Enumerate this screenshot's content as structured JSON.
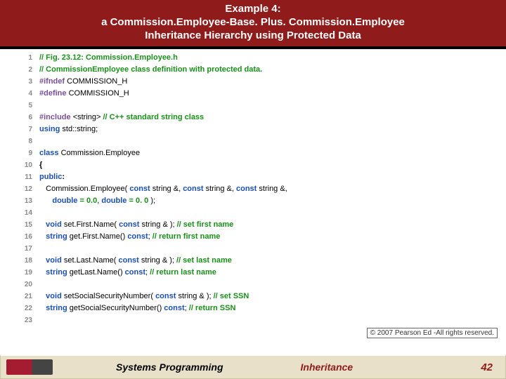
{
  "header": {
    "line1": "Example 4:",
    "line2": "a Commission.Employee-Base. Plus. Commission.Employee",
    "line3": "Inheritance Hierarchy using Protected Data"
  },
  "code": [
    {
      "n": "1",
      "segs": [
        {
          "c": "cmt",
          "t": "// Fig. 23.12: Commission.Employee.h"
        }
      ]
    },
    {
      "n": "2",
      "segs": [
        {
          "c": "cmt",
          "t": "// CommissionEmployee class definition with protected data."
        }
      ]
    },
    {
      "n": "3",
      "segs": [
        {
          "c": "pp",
          "t": "#ifndef "
        },
        {
          "c": "id",
          "t": "COMMISSION_H"
        }
      ]
    },
    {
      "n": "4",
      "segs": [
        {
          "c": "pp",
          "t": "#define "
        },
        {
          "c": "id",
          "t": "COMMISSION_H"
        }
      ]
    },
    {
      "n": "5",
      "segs": []
    },
    {
      "n": "6",
      "segs": [
        {
          "c": "pp",
          "t": "#include "
        },
        {
          "c": "id",
          "t": "<string> "
        },
        {
          "c": "cmt",
          "t": "// C++ standard string class"
        }
      ]
    },
    {
      "n": "7",
      "segs": [
        {
          "c": "kw",
          "t": "using "
        },
        {
          "c": "id",
          "t": "std::string;"
        }
      ]
    },
    {
      "n": "8",
      "segs": []
    },
    {
      "n": "9",
      "segs": [
        {
          "c": "kw",
          "t": "class "
        },
        {
          "c": "id",
          "t": "Commission.Employee"
        }
      ]
    },
    {
      "n": "10",
      "segs": [
        {
          "c": "id bold",
          "t": "{"
        }
      ]
    },
    {
      "n": "11",
      "segs": [
        {
          "c": "kw",
          "t": "public"
        },
        {
          "c": "id bold",
          "t": ":"
        }
      ]
    },
    {
      "n": "12",
      "segs": [
        {
          "c": "id",
          "t": "   Commission.Employee( "
        },
        {
          "c": "kw",
          "t": "const "
        },
        {
          "c": "id",
          "t": "string &, "
        },
        {
          "c": "kw",
          "t": "const "
        },
        {
          "c": "id",
          "t": "string &, "
        },
        {
          "c": "kw",
          "t": "const "
        },
        {
          "c": "id",
          "t": "string &,"
        }
      ]
    },
    {
      "n": "13",
      "segs": [
        {
          "c": "id",
          "t": "      "
        },
        {
          "c": "kw",
          "t": "double "
        },
        {
          "c": "op",
          "t": "= "
        },
        {
          "c": "num",
          "t": "0.0"
        },
        {
          "c": "id",
          "t": ", "
        },
        {
          "c": "kw",
          "t": "double "
        },
        {
          "c": "op",
          "t": "= "
        },
        {
          "c": "num",
          "t": "0. 0 "
        },
        {
          "c": "id",
          "t": ");"
        }
      ]
    },
    {
      "n": "14",
      "segs": []
    },
    {
      "n": "15",
      "segs": [
        {
          "c": "id",
          "t": "   "
        },
        {
          "c": "kw",
          "t": "void "
        },
        {
          "c": "id",
          "t": "set.First.Name( "
        },
        {
          "c": "kw",
          "t": "const "
        },
        {
          "c": "id",
          "t": "string & ); "
        },
        {
          "c": "cmt",
          "t": "// set first name"
        }
      ]
    },
    {
      "n": "16",
      "segs": [
        {
          "c": "id",
          "t": "   "
        },
        {
          "c": "kw",
          "t": "string "
        },
        {
          "c": "id",
          "t": "get.First.Name() "
        },
        {
          "c": "kw",
          "t": "const"
        },
        {
          "c": "id",
          "t": "; "
        },
        {
          "c": "cmt",
          "t": "// return first name"
        }
      ]
    },
    {
      "n": "17",
      "segs": []
    },
    {
      "n": "18",
      "segs": [
        {
          "c": "id",
          "t": "   "
        },
        {
          "c": "kw",
          "t": "void "
        },
        {
          "c": "id",
          "t": "set.Last.Name( "
        },
        {
          "c": "kw",
          "t": "const "
        },
        {
          "c": "id",
          "t": "string & ); "
        },
        {
          "c": "cmt",
          "t": "// set last name"
        }
      ]
    },
    {
      "n": "19",
      "segs": [
        {
          "c": "id",
          "t": "   "
        },
        {
          "c": "kw",
          "t": "string "
        },
        {
          "c": "id",
          "t": "getLast.Name() "
        },
        {
          "c": "kw",
          "t": "const"
        },
        {
          "c": "id",
          "t": "; "
        },
        {
          "c": "cmt",
          "t": "// return last name"
        }
      ]
    },
    {
      "n": "20",
      "segs": []
    },
    {
      "n": "21",
      "segs": [
        {
          "c": "id",
          "t": "   "
        },
        {
          "c": "kw",
          "t": "void "
        },
        {
          "c": "id",
          "t": "setSocialSecurityNumber( "
        },
        {
          "c": "kw",
          "t": "const "
        },
        {
          "c": "id",
          "t": "string & ); "
        },
        {
          "c": "cmt",
          "t": "// set SSN"
        }
      ]
    },
    {
      "n": "22",
      "segs": [
        {
          "c": "id",
          "t": "   "
        },
        {
          "c": "kw",
          "t": "string "
        },
        {
          "c": "id",
          "t": "getSocialSecurityNumber() "
        },
        {
          "c": "kw",
          "t": "const"
        },
        {
          "c": "id",
          "t": "; "
        },
        {
          "c": "cmt",
          "t": "// return SSN"
        }
      ]
    },
    {
      "n": "23",
      "segs": []
    }
  ],
  "copyright": "© 2007 Pearson Ed -All rights reserved.",
  "footer": {
    "left": "Systems Programming",
    "mid": "Inheritance",
    "page": "42"
  }
}
